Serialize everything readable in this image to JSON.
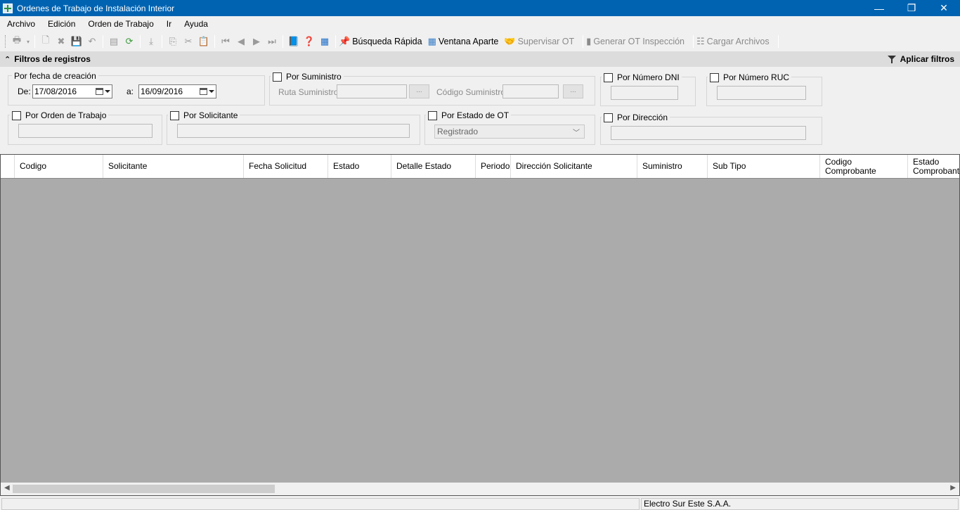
{
  "window": {
    "title": "Ordenes de Trabajo de Instalación Interior",
    "minimize": "—",
    "restore": "❐",
    "close": "✕"
  },
  "menu": [
    "Archivo",
    "Edición",
    "Orden de Trabajo",
    "Ir",
    "Ayuda"
  ],
  "toolbar": {
    "quick_search": "Búsqueda Rápida",
    "separate_window": "Ventana Aparte",
    "supervise_ot": "Supervisar OT",
    "generate_inspection": "Generar OT Inspección",
    "load_files": "Cargar Archivos"
  },
  "filters": {
    "header": "Filtros de registros",
    "apply": "Aplicar filtros",
    "creation_date": {
      "title": "Por fecha de creación",
      "from_label": "De:",
      "from_value": "17/08/2016",
      "to_label": "a:",
      "to_value": "16/09/2016"
    },
    "supply": {
      "title": "Por Suministro",
      "route_label": "Ruta Suministro:",
      "code_label": "Código Suministro:",
      "button": "..."
    },
    "dni": {
      "title": "Por Número DNI"
    },
    "ruc": {
      "title": "Por Número RUC"
    },
    "work_order": {
      "title": "Por Orden de Trabajo"
    },
    "requester": {
      "title": "Por Solicitante"
    },
    "ot_state": {
      "title": "Por Estado de OT",
      "selected": "Registrado"
    },
    "address": {
      "title": "Por Dirección"
    }
  },
  "grid": {
    "columns": [
      "Codigo",
      "Solicitante",
      "Fecha Solicitud",
      "Estado",
      "Detalle Estado",
      "Periodo",
      "Dirección Solicitante",
      "Suministro",
      "Sub Tipo",
      "Codigo\nComprobante",
      "Estado\nComprobante"
    ]
  },
  "status": {
    "company": "Electro Sur Este S.A.A."
  }
}
